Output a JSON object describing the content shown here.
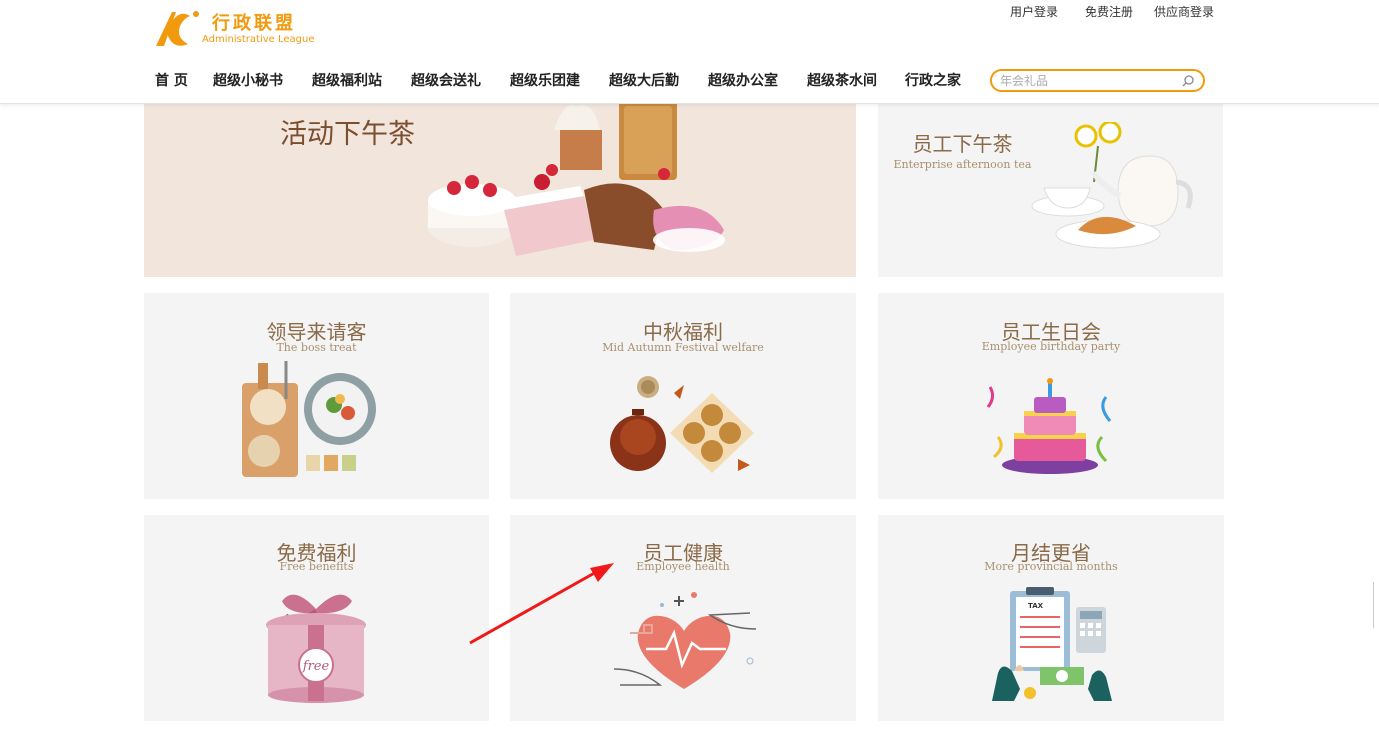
{
  "header": {
    "logo_cn": "行政联盟",
    "logo_en": "Administrative League",
    "top_links": [
      "用户登录",
      "免费注册",
      "供应商登录"
    ],
    "nav": [
      "首 页",
      "超级小秘书",
      "超级福利站",
      "超级会送礼",
      "超级乐团建",
      "超级大后勤",
      "超级办公室",
      "超级茶水间",
      "行政之家"
    ],
    "search_placeholder": "年会礼品"
  },
  "banner": {
    "title": "活动下午茶"
  },
  "cards": [
    {
      "title": "员工下午茶",
      "subtitle": "Enterprise afternoon tea",
      "icon": "teapot-icon"
    },
    {
      "title": "领导来请客",
      "subtitle": "The boss treat",
      "icon": "food-platter-icon"
    },
    {
      "title": "中秋福利",
      "subtitle": "Mid Autumn Festival welfare",
      "icon": "mooncake-icon"
    },
    {
      "title": "员工生日会",
      "subtitle": "Employee birthday party",
      "icon": "birthday-cake-icon"
    },
    {
      "title": "免费福利",
      "subtitle": "Free benefits",
      "icon": "gift-box-icon",
      "badge": "free"
    },
    {
      "title": "员工健康",
      "subtitle": "Employee health",
      "icon": "heart-health-icon"
    },
    {
      "title": "月结更省",
      "subtitle": "More provincial months",
      "icon": "tax-calculator-icon",
      "badge": "TAX"
    }
  ],
  "colors": {
    "accent": "#f29a0e",
    "card_bg": "#f4f4f4",
    "title": "#8a6a48",
    "annotation_arrow": "#f01818"
  }
}
